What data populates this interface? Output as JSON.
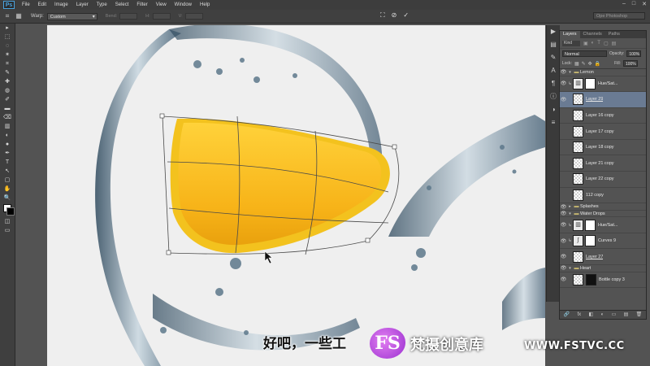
{
  "menubar": {
    "logo": "Ps",
    "items": [
      "File",
      "Edit",
      "Image",
      "Layer",
      "Type",
      "Select",
      "Filter",
      "View",
      "Window",
      "Help"
    ],
    "window_controls": [
      "‒",
      "□",
      "✕"
    ]
  },
  "options": {
    "warp_label": "Warp:",
    "warp_value": "Custom",
    "bend_label": "Bend:",
    "h_label": "H:",
    "v_label": "V:",
    "workspace": "Ope Photoshop"
  },
  "tools": [
    "▸",
    "⬚",
    "◌",
    "✶",
    "⌗",
    "✎",
    "✚",
    "◍",
    "✐",
    "▬",
    "⌫",
    "▥",
    "◐",
    "●",
    "✒",
    "T",
    "↖",
    "▢",
    "✋",
    "🔍"
  ],
  "layers_panel": {
    "tabs": [
      "Layers",
      "Channels",
      "Paths"
    ],
    "kind": "Kind",
    "blend_mode": "Normal",
    "opacity_label": "Opacity:",
    "opacity": "100%",
    "lock_label": "Lock:",
    "fill_label": "Fill:",
    "fill": "100%",
    "items": [
      {
        "name": "Lemon",
        "type": "group"
      },
      {
        "name": "Hue/Sat...",
        "type": "adj"
      },
      {
        "name": "Layer 29",
        "type": "layer",
        "selected": true
      },
      {
        "name": "Layer 16 copy",
        "type": "layer"
      },
      {
        "name": "Layer 17 copy",
        "type": "layer"
      },
      {
        "name": "Layer 18 copy",
        "type": "layer"
      },
      {
        "name": "Layer 21 copy",
        "type": "layer"
      },
      {
        "name": "Layer 22 copy",
        "type": "layer"
      },
      {
        "name": "112 copy",
        "type": "layer"
      },
      {
        "name": "Splashes",
        "type": "group"
      },
      {
        "name": "Water Drops",
        "type": "group"
      },
      {
        "name": "Hue/Sat...",
        "type": "adj"
      },
      {
        "name": "Curves 9",
        "type": "adj"
      },
      {
        "name": "Layer 27",
        "type": "layer"
      },
      {
        "name": "Heart",
        "type": "group"
      },
      {
        "name": "Bottle copy 3",
        "type": "layer"
      }
    ],
    "footer_icons": [
      "🔗",
      "fx",
      "◧",
      "◐",
      "▭",
      "▤",
      "🗑"
    ]
  },
  "subtitle": "好吧，一些工",
  "watermark": {
    "logo": "FS",
    "name": "梵摄创意库",
    "url": "WWW.FSTVC.CC"
  }
}
